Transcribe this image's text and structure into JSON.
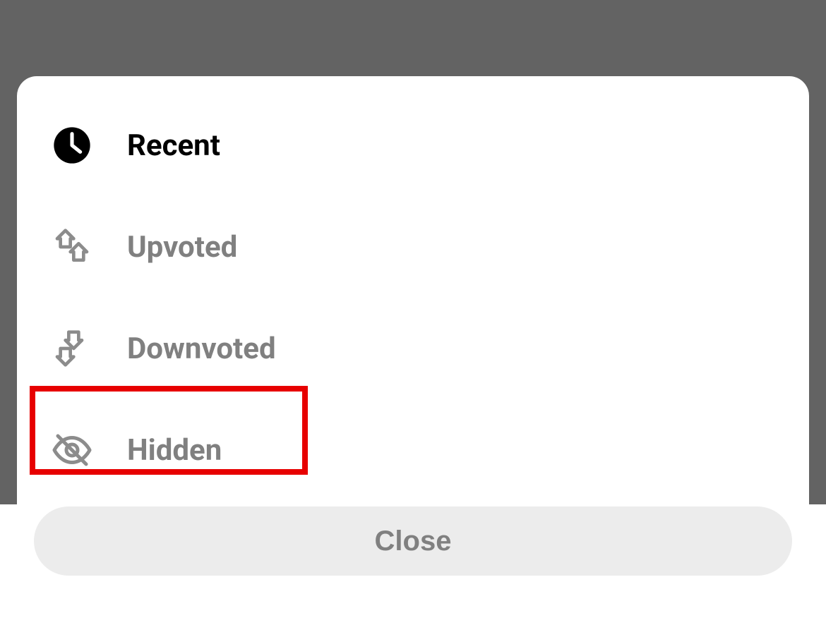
{
  "menu": {
    "options": [
      {
        "id": "recent",
        "label": "Recent",
        "icon": "clock-icon",
        "selected": true
      },
      {
        "id": "upvoted",
        "label": "Upvoted",
        "icon": "upvote-icon",
        "selected": false
      },
      {
        "id": "downvoted",
        "label": "Downvoted",
        "icon": "downvote-icon",
        "selected": false
      },
      {
        "id": "hidden",
        "label": "Hidden",
        "icon": "eye-off-icon",
        "selected": false
      }
    ],
    "close_label": "Close"
  },
  "highlight": {
    "target": "hidden"
  }
}
